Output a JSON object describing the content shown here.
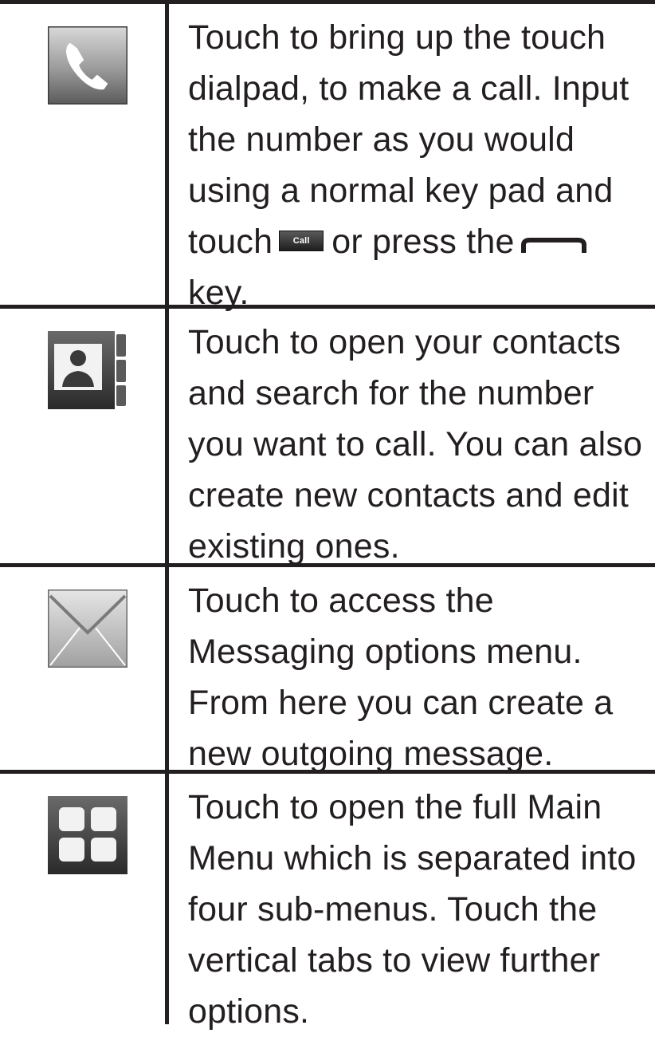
{
  "rows": [
    {
      "icon": "phone-icon",
      "lines": [
        "Touch to bring up the touch",
        "dialpad, to make a call. Input",
        "the number as you would",
        "using a normal key pad and"
      ],
      "line5_start": "touch",
      "call_button_label": "Call",
      "line5_mid": "or press the",
      "inline_key_icon": "send-key-icon",
      "line6": "key."
    },
    {
      "icon": "contacts-book-icon",
      "lines": [
        "Touch to open your contacts",
        "and search for the number",
        "you want to call. You can also",
        "create new contacts and edit",
        "existing ones."
      ]
    },
    {
      "icon": "envelope-icon",
      "lines": [
        "Touch to access the",
        "Messaging options menu.",
        "From here you can create a",
        "new outgoing message."
      ]
    },
    {
      "icon": "main-menu-grid-icon",
      "lines": [
        "Touch to open the full Main",
        "Menu which is separated into",
        "four sub-menus. Touch the",
        "vertical tabs to view further",
        "options."
      ]
    }
  ],
  "colors": {
    "text": "#231f20",
    "rule": "#231f20",
    "icon_gray_light": "#c8c8c8",
    "icon_gray_dark": "#4a4a4a"
  }
}
